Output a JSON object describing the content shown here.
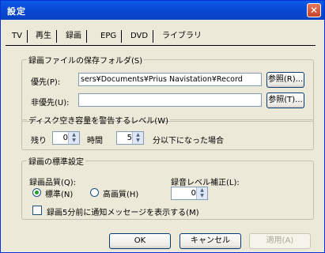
{
  "window": {
    "title": "設定",
    "close_symbol": "✕"
  },
  "tabs": [
    {
      "label": "TV"
    },
    {
      "label": "再生"
    },
    {
      "label": "録画"
    },
    {
      "label": "EPG"
    },
    {
      "label": "DVD"
    },
    {
      "label": "ライブラリ"
    }
  ],
  "save_folder": {
    "legend": "録画ファイルの保存フォルダ(S)",
    "primary_label": "優先(P):",
    "primary_value": "sers¥Documents¥Prius Navistation¥Record",
    "primary_browse": "参照(R)...",
    "secondary_label": "非優先(U):",
    "secondary_value": "",
    "secondary_browse": "参照(T)..."
  },
  "disk_warning": {
    "legend": "ディスク空き容量を警告するレベル(W)",
    "remaining_label": "残り",
    "remaining_value": "0",
    "hours_label": "時間",
    "minutes_value": "5",
    "suffix": "分以下になった場合"
  },
  "recording_defaults": {
    "legend": "録画の標準設定",
    "quality_label": "録画品質(Q):",
    "quality_standard": "標準(N)",
    "quality_high": "高画質(H)",
    "quality_selected": "standard",
    "audio_label": "録音レベル補正(L):",
    "audio_value": "0",
    "notify_label": "録画5分前に通知メッセージを表示する(M)",
    "notify_checked": false
  },
  "footer": {
    "ok": "OK",
    "cancel": "キャンセル",
    "apply": "適用(A)"
  }
}
